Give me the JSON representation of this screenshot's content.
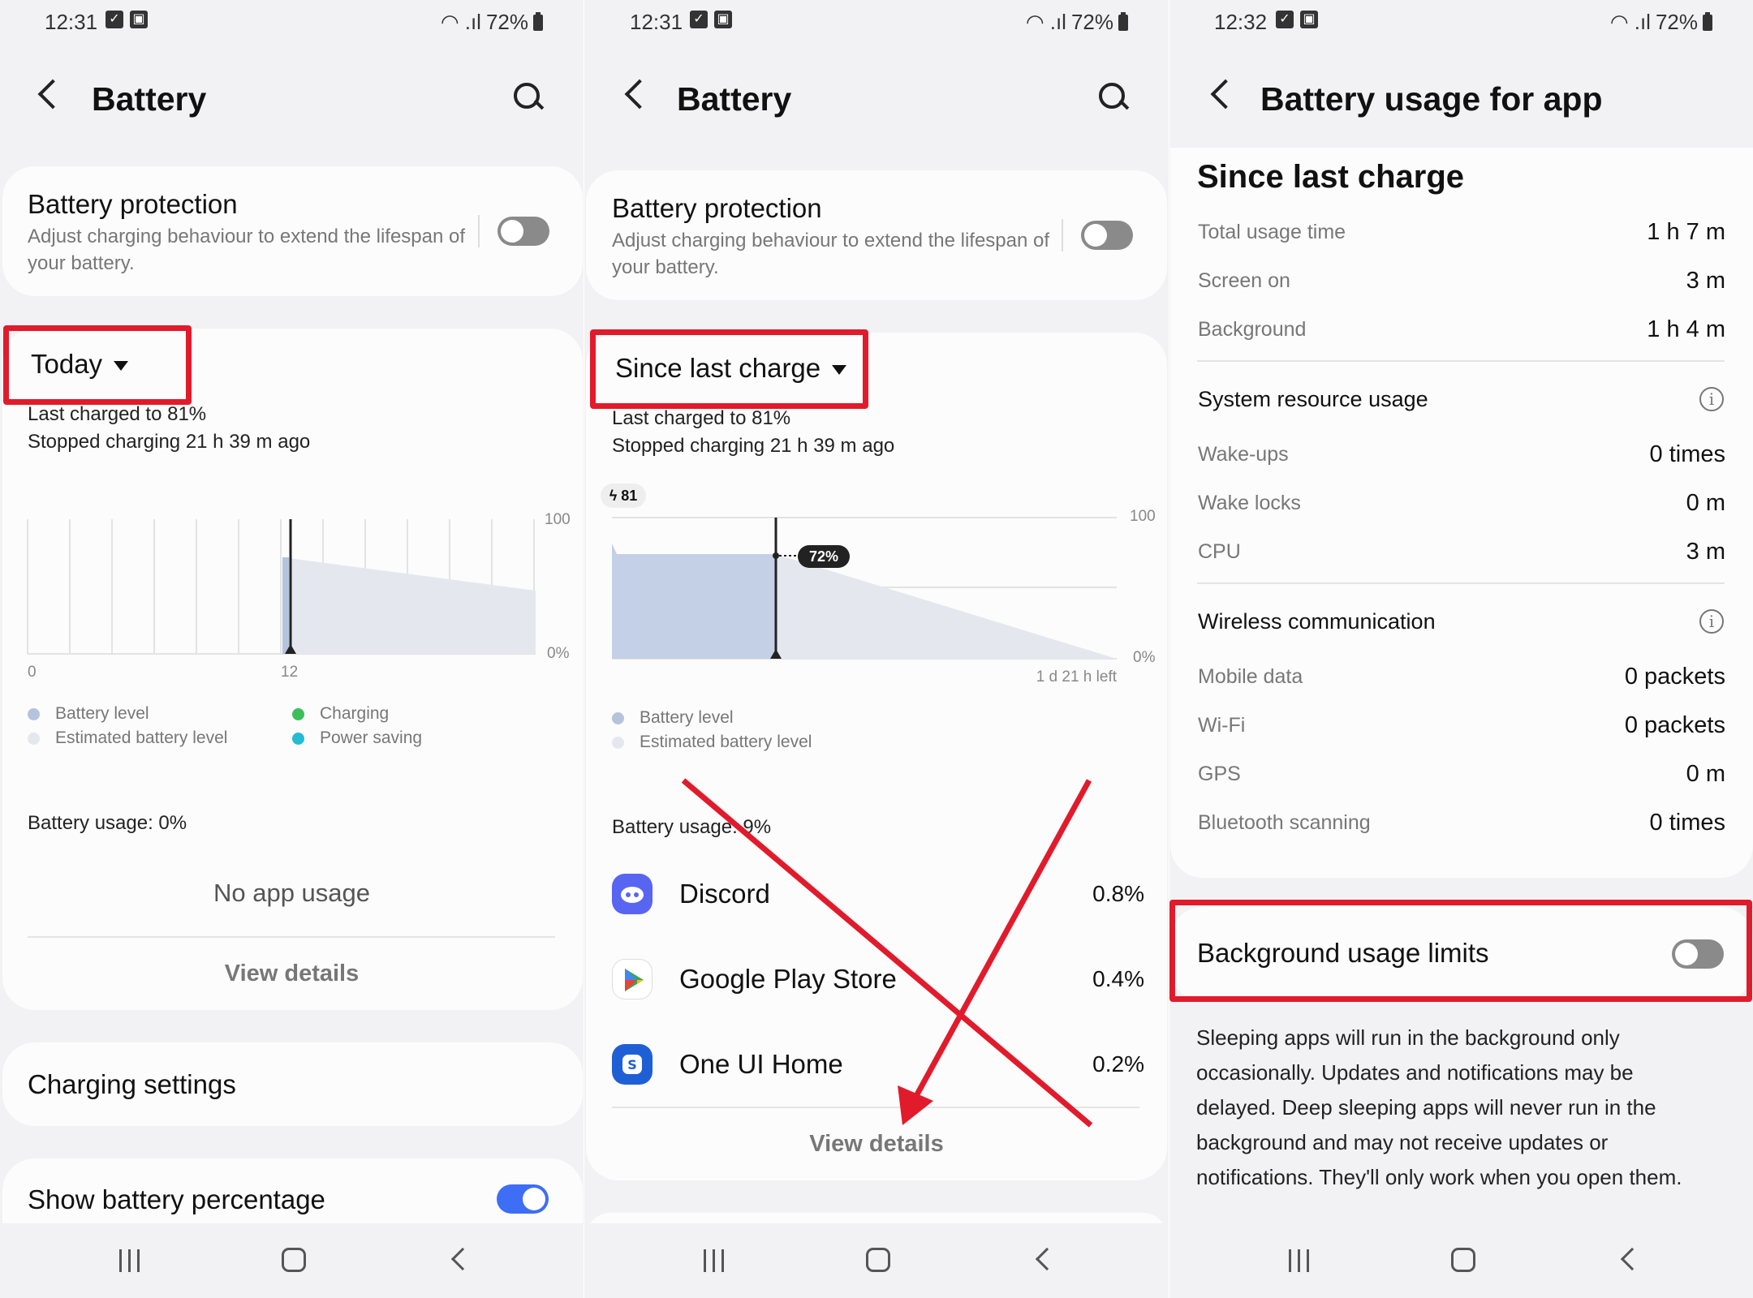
{
  "screens": [
    {
      "status": {
        "time": "12:31",
        "battery": "72%"
      },
      "title": "Battery",
      "battery_protection": {
        "title": "Battery protection",
        "desc": "Adjust charging behaviour to extend the lifespan of your battery."
      },
      "period": "Today",
      "last_charged": "Last charged to 81%",
      "stopped": "Stopped charging 21 h 39 m ago",
      "axis": {
        "y_top": "100",
        "y_bottom": "0%",
        "x_left": "0",
        "x_mid": "12"
      },
      "legend": [
        {
          "label": "Battery level",
          "color": "#b5c3dc"
        },
        {
          "label": "Estimated battery level",
          "color": "#e4e8ee"
        },
        {
          "label": "Charging",
          "color": "#3cbf5a"
        },
        {
          "label": "Power saving",
          "color": "#23bcd2"
        }
      ],
      "usage": "Battery usage: 0%",
      "no_usage": "No app usage",
      "view_details": "View details",
      "charging_settings": "Charging settings",
      "show_pct": "Show battery percentage"
    },
    {
      "status": {
        "time": "12:31",
        "battery": "72%"
      },
      "title": "Battery",
      "battery_protection": {
        "title": "Battery protection",
        "desc": "Adjust charging behaviour to extend the lifespan of your battery."
      },
      "period": "Since last charge",
      "last_charged": "Last charged to 81%",
      "stopped": "Stopped charging 21 h 39 m ago",
      "charge_badge": "81",
      "current_badge": "72%",
      "axis": {
        "y_top": "100",
        "y_bottom": "0%",
        "time_left": "1 d 21 h left"
      },
      "legend": [
        {
          "label": "Battery level",
          "color": "#b5c3dc"
        },
        {
          "label": "Estimated battery level",
          "color": "#e4e8ee"
        }
      ],
      "usage": "Battery usage: 9%",
      "apps": [
        {
          "name": "Discord",
          "pct": "0.8%",
          "icon": "discord-icon",
          "color": "#5865f2"
        },
        {
          "name": "Google Play Store",
          "pct": "0.4%",
          "icon": "play-store-icon",
          "color": "#ffffff"
        },
        {
          "name": "One UI Home",
          "pct": "0.2%",
          "icon": "one-ui-home-icon",
          "color": "#1f5fd6"
        }
      ],
      "view_details": "View details"
    },
    {
      "status": {
        "time": "12:32",
        "battery": "72%"
      },
      "title": "Battery usage for app",
      "section": "Since last charge",
      "rows1": [
        {
          "label": "Total usage time",
          "value": "1 h 7 m"
        },
        {
          "label": "Screen on",
          "value": "3 m"
        },
        {
          "label": "Background",
          "value": "1 h 4 m"
        }
      ],
      "system_resource": "System resource usage",
      "rows2": [
        {
          "label": "Wake-ups",
          "value": "0 times"
        },
        {
          "label": "Wake locks",
          "value": "0 m"
        },
        {
          "label": "CPU",
          "value": "3 m"
        }
      ],
      "wireless": "Wireless communication",
      "rows3": [
        {
          "label": "Mobile data",
          "value": "0 packets"
        },
        {
          "label": "Wi-Fi",
          "value": "0 packets"
        },
        {
          "label": "GPS",
          "value": "0 m"
        },
        {
          "label": "Bluetooth scanning",
          "value": "0 times"
        }
      ],
      "bg_limits": "Background usage limits",
      "sleep_text": "Sleeping apps will run in the background only occasionally. Updates and notifications may be delayed. Deep sleeping apps will never run in the background and may not receive updates or notifications. They'll only work when you open them."
    }
  ],
  "colors": {
    "highlight": "#e11b2b",
    "toggle_on": "#3e6ef5",
    "toggle_off": "#8a8a8a"
  }
}
